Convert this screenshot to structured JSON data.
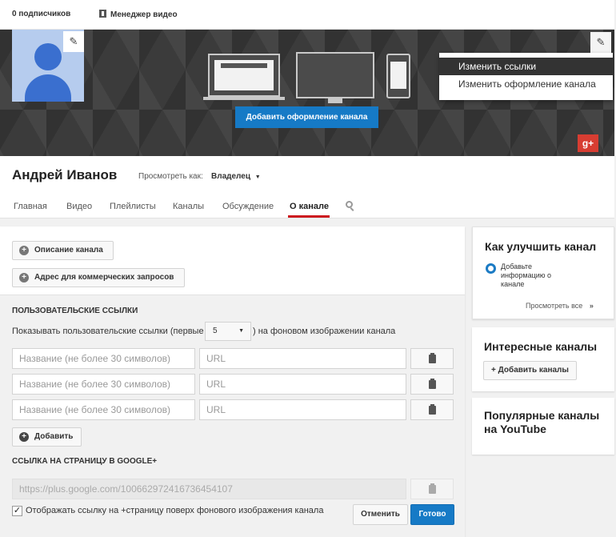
{
  "topbar": {
    "subscribers": "0 подписчиков",
    "video_manager": "Менеджер видео"
  },
  "banner": {
    "add_art_label": "Добавить оформление канала",
    "menu": [
      "Изменить ссылки",
      "Изменить оформление канала"
    ],
    "gplus_label": "g+"
  },
  "channel": {
    "name": "Андрей Иванов",
    "view_as_label": "Просмотреть как:",
    "view_as_value": "Владелец",
    "tabs": [
      "Главная",
      "Видео",
      "Плейлисты",
      "Каналы",
      "Обсуждение",
      "О канале"
    ]
  },
  "about": {
    "description_button": "Описание канала",
    "business_button": "Адрес для коммерческих запросов",
    "custom_links_title": "ПОЛЬЗОВАТЕЛЬСКИЕ ССЫЛКИ",
    "show_links_prefix": "Показывать пользовательские ссылки (первые",
    "show_links_count": "5",
    "show_links_suffix": ") на фоновом изображении канала",
    "name_placeholder": "Название (не более 30 символов)",
    "url_placeholder": "URL",
    "add_button": "Добавить",
    "gplus_section_title": "ССЫЛКА НА СТРАНИЦУ В GOOGLE+",
    "gplus_url": "https://plus.google.com/100662972416736454107",
    "gplus_checkbox_label": "Отображать ссылку на +страницу поверх фонового изображения канала",
    "cancel_button": "Отменить",
    "done_button": "Готово"
  },
  "sidebar": {
    "improve_title": "Как улучшить канал",
    "improve_item": "Добавьте информацию о канале",
    "view_all": "Просмотреть все",
    "featured_title": "Интересные каналы",
    "add_channels_button": "+ Добавить каналы",
    "popular_title": "Популярные каналы на YouTube"
  },
  "colors": {
    "accent": "#167ac6",
    "tab_underline": "#cc181e",
    "gplus": "#d73d32"
  }
}
